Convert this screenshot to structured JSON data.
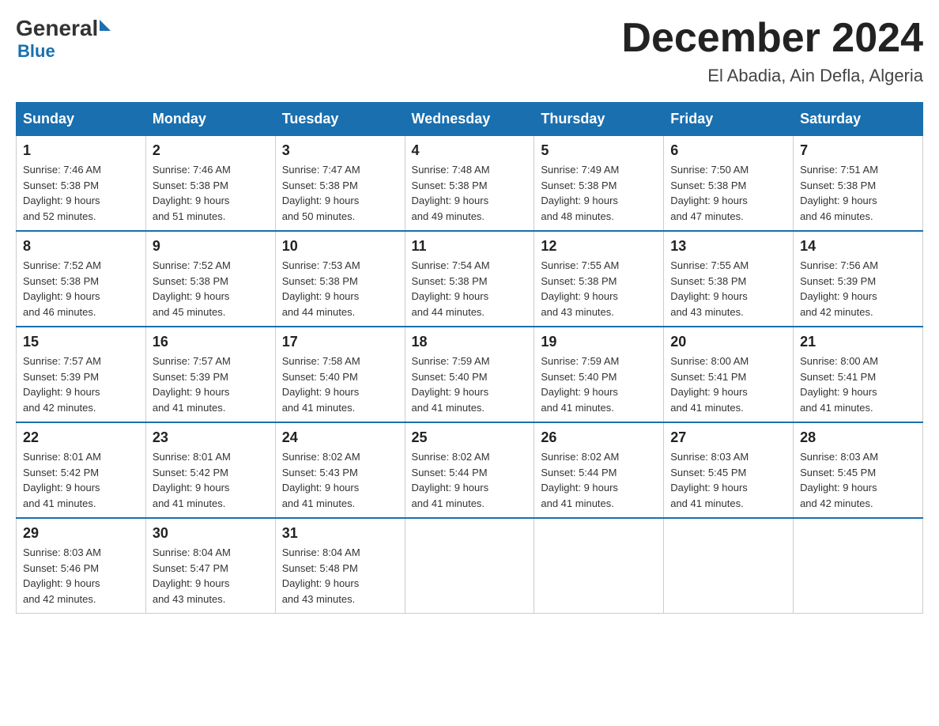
{
  "header": {
    "logo": {
      "general": "General",
      "blue": "Blue"
    },
    "title": "December 2024",
    "subtitle": "El Abadia, Ain Defla, Algeria"
  },
  "days_of_week": [
    "Sunday",
    "Monday",
    "Tuesday",
    "Wednesday",
    "Thursday",
    "Friday",
    "Saturday"
  ],
  "weeks": [
    [
      {
        "day": "1",
        "sunrise": "7:46 AM",
        "sunset": "5:38 PM",
        "daylight": "9 hours and 52 minutes."
      },
      {
        "day": "2",
        "sunrise": "7:46 AM",
        "sunset": "5:38 PM",
        "daylight": "9 hours and 51 minutes."
      },
      {
        "day": "3",
        "sunrise": "7:47 AM",
        "sunset": "5:38 PM",
        "daylight": "9 hours and 50 minutes."
      },
      {
        "day": "4",
        "sunrise": "7:48 AM",
        "sunset": "5:38 PM",
        "daylight": "9 hours and 49 minutes."
      },
      {
        "day": "5",
        "sunrise": "7:49 AM",
        "sunset": "5:38 PM",
        "daylight": "9 hours and 48 minutes."
      },
      {
        "day": "6",
        "sunrise": "7:50 AM",
        "sunset": "5:38 PM",
        "daylight": "9 hours and 47 minutes."
      },
      {
        "day": "7",
        "sunrise": "7:51 AM",
        "sunset": "5:38 PM",
        "daylight": "9 hours and 46 minutes."
      }
    ],
    [
      {
        "day": "8",
        "sunrise": "7:52 AM",
        "sunset": "5:38 PM",
        "daylight": "9 hours and 46 minutes."
      },
      {
        "day": "9",
        "sunrise": "7:52 AM",
        "sunset": "5:38 PM",
        "daylight": "9 hours and 45 minutes."
      },
      {
        "day": "10",
        "sunrise": "7:53 AM",
        "sunset": "5:38 PM",
        "daylight": "9 hours and 44 minutes."
      },
      {
        "day": "11",
        "sunrise": "7:54 AM",
        "sunset": "5:38 PM",
        "daylight": "9 hours and 44 minutes."
      },
      {
        "day": "12",
        "sunrise": "7:55 AM",
        "sunset": "5:38 PM",
        "daylight": "9 hours and 43 minutes."
      },
      {
        "day": "13",
        "sunrise": "7:55 AM",
        "sunset": "5:38 PM",
        "daylight": "9 hours and 43 minutes."
      },
      {
        "day": "14",
        "sunrise": "7:56 AM",
        "sunset": "5:39 PM",
        "daylight": "9 hours and 42 minutes."
      }
    ],
    [
      {
        "day": "15",
        "sunrise": "7:57 AM",
        "sunset": "5:39 PM",
        "daylight": "9 hours and 42 minutes."
      },
      {
        "day": "16",
        "sunrise": "7:57 AM",
        "sunset": "5:39 PM",
        "daylight": "9 hours and 41 minutes."
      },
      {
        "day": "17",
        "sunrise": "7:58 AM",
        "sunset": "5:40 PM",
        "daylight": "9 hours and 41 minutes."
      },
      {
        "day": "18",
        "sunrise": "7:59 AM",
        "sunset": "5:40 PM",
        "daylight": "9 hours and 41 minutes."
      },
      {
        "day": "19",
        "sunrise": "7:59 AM",
        "sunset": "5:40 PM",
        "daylight": "9 hours and 41 minutes."
      },
      {
        "day": "20",
        "sunrise": "8:00 AM",
        "sunset": "5:41 PM",
        "daylight": "9 hours and 41 minutes."
      },
      {
        "day": "21",
        "sunrise": "8:00 AM",
        "sunset": "5:41 PM",
        "daylight": "9 hours and 41 minutes."
      }
    ],
    [
      {
        "day": "22",
        "sunrise": "8:01 AM",
        "sunset": "5:42 PM",
        "daylight": "9 hours and 41 minutes."
      },
      {
        "day": "23",
        "sunrise": "8:01 AM",
        "sunset": "5:42 PM",
        "daylight": "9 hours and 41 minutes."
      },
      {
        "day": "24",
        "sunrise": "8:02 AM",
        "sunset": "5:43 PM",
        "daylight": "9 hours and 41 minutes."
      },
      {
        "day": "25",
        "sunrise": "8:02 AM",
        "sunset": "5:44 PM",
        "daylight": "9 hours and 41 minutes."
      },
      {
        "day": "26",
        "sunrise": "8:02 AM",
        "sunset": "5:44 PM",
        "daylight": "9 hours and 41 minutes."
      },
      {
        "day": "27",
        "sunrise": "8:03 AM",
        "sunset": "5:45 PM",
        "daylight": "9 hours and 41 minutes."
      },
      {
        "day": "28",
        "sunrise": "8:03 AM",
        "sunset": "5:45 PM",
        "daylight": "9 hours and 42 minutes."
      }
    ],
    [
      {
        "day": "29",
        "sunrise": "8:03 AM",
        "sunset": "5:46 PM",
        "daylight": "9 hours and 42 minutes."
      },
      {
        "day": "30",
        "sunrise": "8:04 AM",
        "sunset": "5:47 PM",
        "daylight": "9 hours and 43 minutes."
      },
      {
        "day": "31",
        "sunrise": "8:04 AM",
        "sunset": "5:48 PM",
        "daylight": "9 hours and 43 minutes."
      },
      null,
      null,
      null,
      null
    ]
  ],
  "labels": {
    "sunrise": "Sunrise:",
    "sunset": "Sunset:",
    "daylight": "Daylight:"
  }
}
